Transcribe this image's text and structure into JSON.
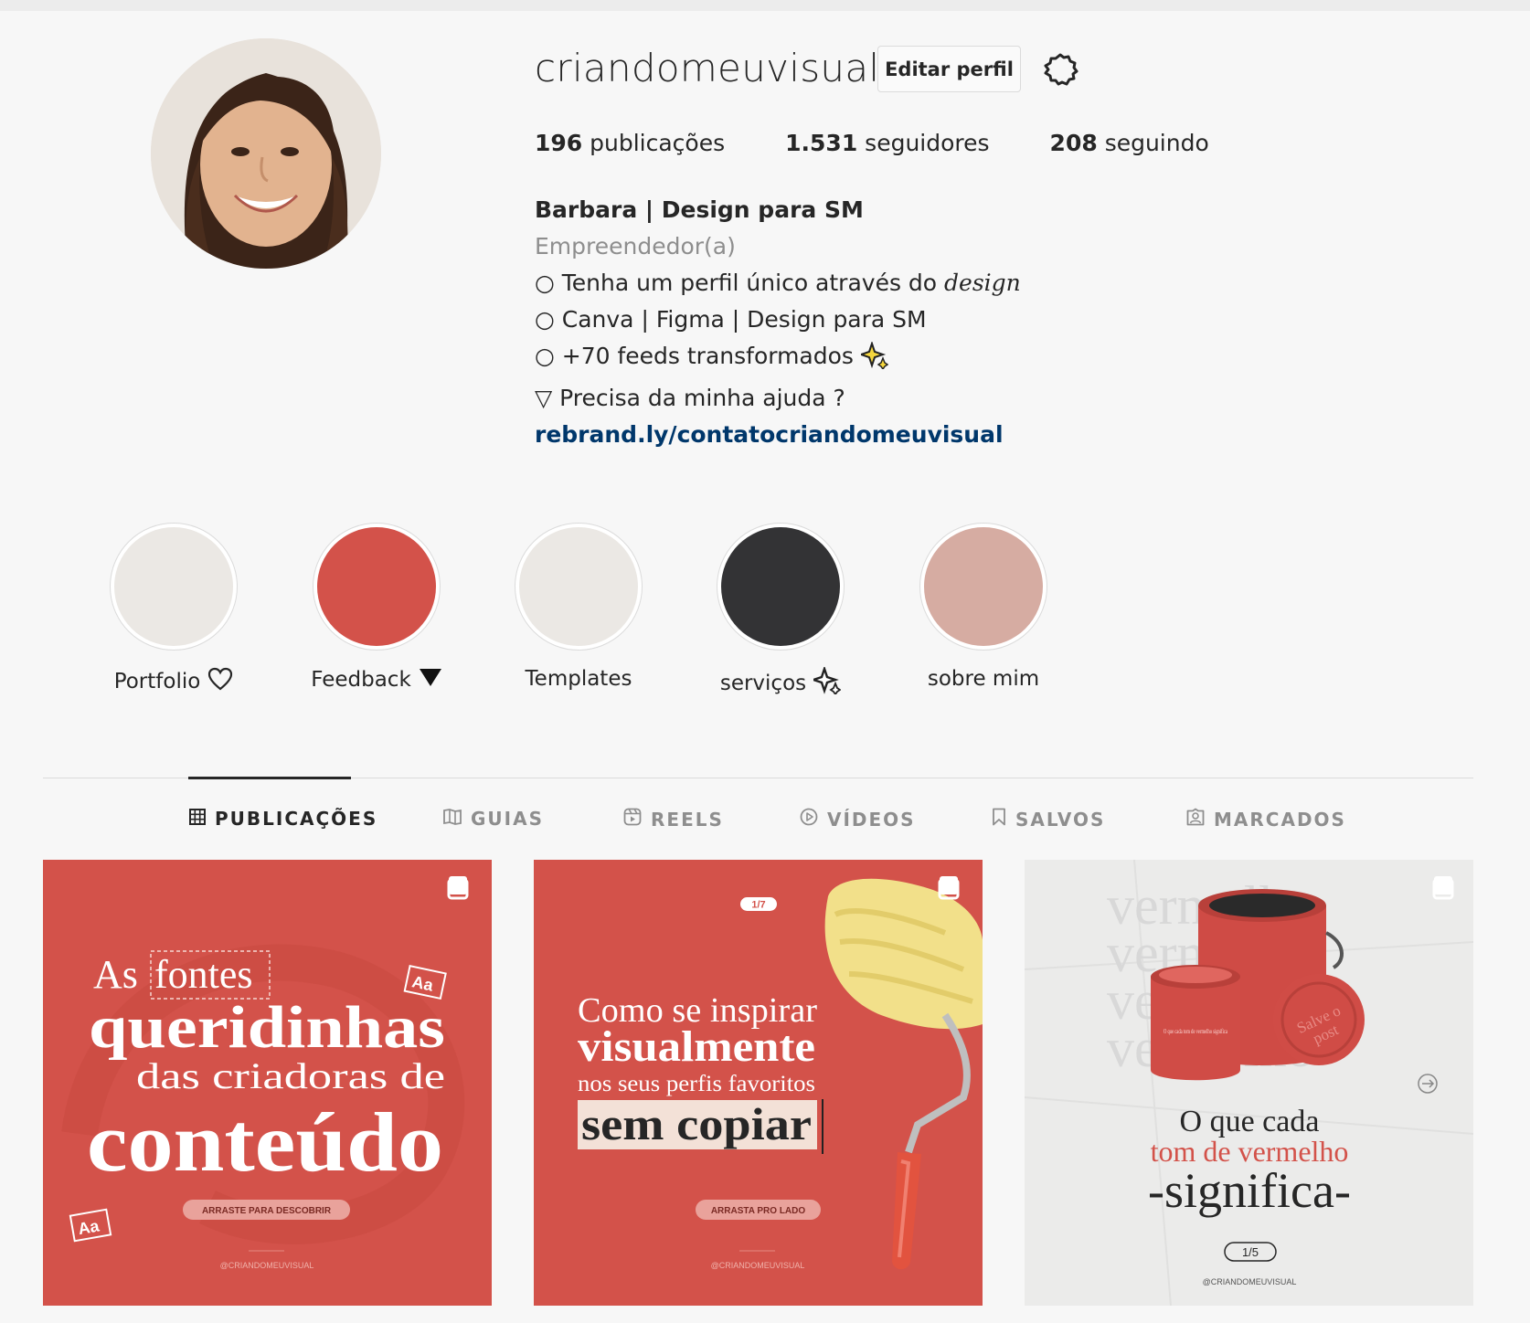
{
  "profile": {
    "username": "criandomeuvisual",
    "edit_label": "Editar perfil",
    "stats": [
      {
        "count": "196",
        "label": "publicações"
      },
      {
        "count": "1.531",
        "label": "seguidores"
      },
      {
        "count": "208",
        "label": "seguindo"
      }
    ],
    "bio": {
      "name": "Barbara | Design para SM",
      "category": "Empreendedor(a)",
      "line1_prefix": "○ Tenha um perfil único através do ",
      "line1_emph": "design",
      "line2": "○ Canva | Figma | Design para SM",
      "line3": "○ +70 feeds transformados",
      "line4": "▽ Precisa da minha ajuda ?",
      "link": "rebrand.ly/contatocriandomeuvisual"
    }
  },
  "highlights": [
    {
      "label": "Portfolio",
      "color": "#ebe8e4",
      "icon": "heart-icon"
    },
    {
      "label": "Feedback",
      "color": "#d3524a",
      "icon": "triangle-down-icon"
    },
    {
      "label": "Templates",
      "color": "#ebe8e4",
      "icon": ""
    },
    {
      "label": "serviços",
      "color": "#333335",
      "icon": "sparkle-icon"
    },
    {
      "label": "sobre mim",
      "color": "#d6aca2",
      "icon": ""
    }
  ],
  "tabs": [
    {
      "label": "PUBLICAÇÕES",
      "icon": "grid-icon",
      "active": true
    },
    {
      "label": "GUIAS",
      "icon": "guide-icon"
    },
    {
      "label": "REELS",
      "icon": "reels-icon"
    },
    {
      "label": "VÍDEOS",
      "icon": "video-icon"
    },
    {
      "label": "SALVOS",
      "icon": "bookmark-icon"
    },
    {
      "label": "MARCADOS",
      "icon": "tagged-icon"
    }
  ],
  "posts": [
    {
      "bg": "#d3524a",
      "line1a": "As",
      "line1b": "fontes",
      "line2": "queridinhas",
      "line3": "das criadoras de",
      "line4": "conteúdo",
      "badge": "Aa",
      "cta": "ARRASTE PARA DESCOBRIR",
      "handle": "@CRIANDOMEUVISUAL"
    },
    {
      "bg": "#d3524a",
      "pager": "1/7",
      "line1": "Como se inspirar",
      "line2": "visualmente",
      "line3": "nos seus perfis favoritos",
      "line4": "sem copiar",
      "cta": "ARRASTA PRO LADO",
      "handle": "@CRIANDOMEUVISUAL"
    },
    {
      "bg": "#ebebea",
      "bg_word": "vermelho",
      "can_small": "O que cada tom de vermelho significa",
      "lid1": "Salve o",
      "lid2": "post",
      "line1": "O que cada",
      "line2": "tom de vermelho",
      "line3": "-significa-",
      "pager": "1/5",
      "handle": "@CRIANDOMEUVISUAL"
    }
  ]
}
